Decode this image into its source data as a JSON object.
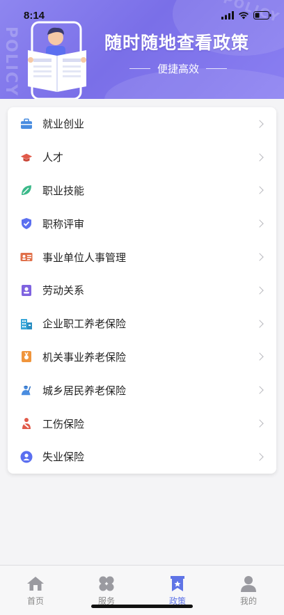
{
  "status_bar": {
    "time": "8:14"
  },
  "banner": {
    "title": "随时随地查看政策",
    "subtitle": "便捷高效",
    "watermark": "POLICY",
    "watermark_corner": "POLICY"
  },
  "menu": {
    "items": [
      {
        "label": "就业创业",
        "icon": "briefcase-icon",
        "color": "#4a8de0"
      },
      {
        "label": "人才",
        "icon": "graduation-cap-icon",
        "color": "#e15a4a"
      },
      {
        "label": "职业技能",
        "icon": "leaf-tag-icon",
        "color": "#3cb98a"
      },
      {
        "label": "职称评审",
        "icon": "shield-check-icon",
        "color": "#5b6ff0"
      },
      {
        "label": "事业单位人事管理",
        "icon": "id-card-icon",
        "color": "#e0704a"
      },
      {
        "label": "劳动关系",
        "icon": "badge-person-icon",
        "color": "#7f63e0"
      },
      {
        "label": "企业职工养老保险",
        "icon": "building-icon",
        "color": "#3aa7d8"
      },
      {
        "label": "机关事业养老保险",
        "icon": "medal-icon",
        "color": "#f0953c"
      },
      {
        "label": "城乡居民养老保险",
        "icon": "worker-icon",
        "color": "#4a8de0"
      },
      {
        "label": "工伤保险",
        "icon": "injured-person-icon",
        "color": "#e15a4a"
      },
      {
        "label": "失业保险",
        "icon": "person-circle-icon",
        "color": "#5b6ff0"
      }
    ]
  },
  "tabbar": {
    "tabs": [
      {
        "label": "首页",
        "icon": "home-icon",
        "active": false
      },
      {
        "label": "服务",
        "icon": "clover-icon",
        "active": false
      },
      {
        "label": "政策",
        "icon": "bookmark-star-icon",
        "active": true
      },
      {
        "label": "我的",
        "icon": "user-icon",
        "active": false
      }
    ]
  },
  "colors": {
    "accent": "#5f74e6",
    "banner_start": "#8e86f0",
    "banner_end": "#7a6fe8"
  }
}
